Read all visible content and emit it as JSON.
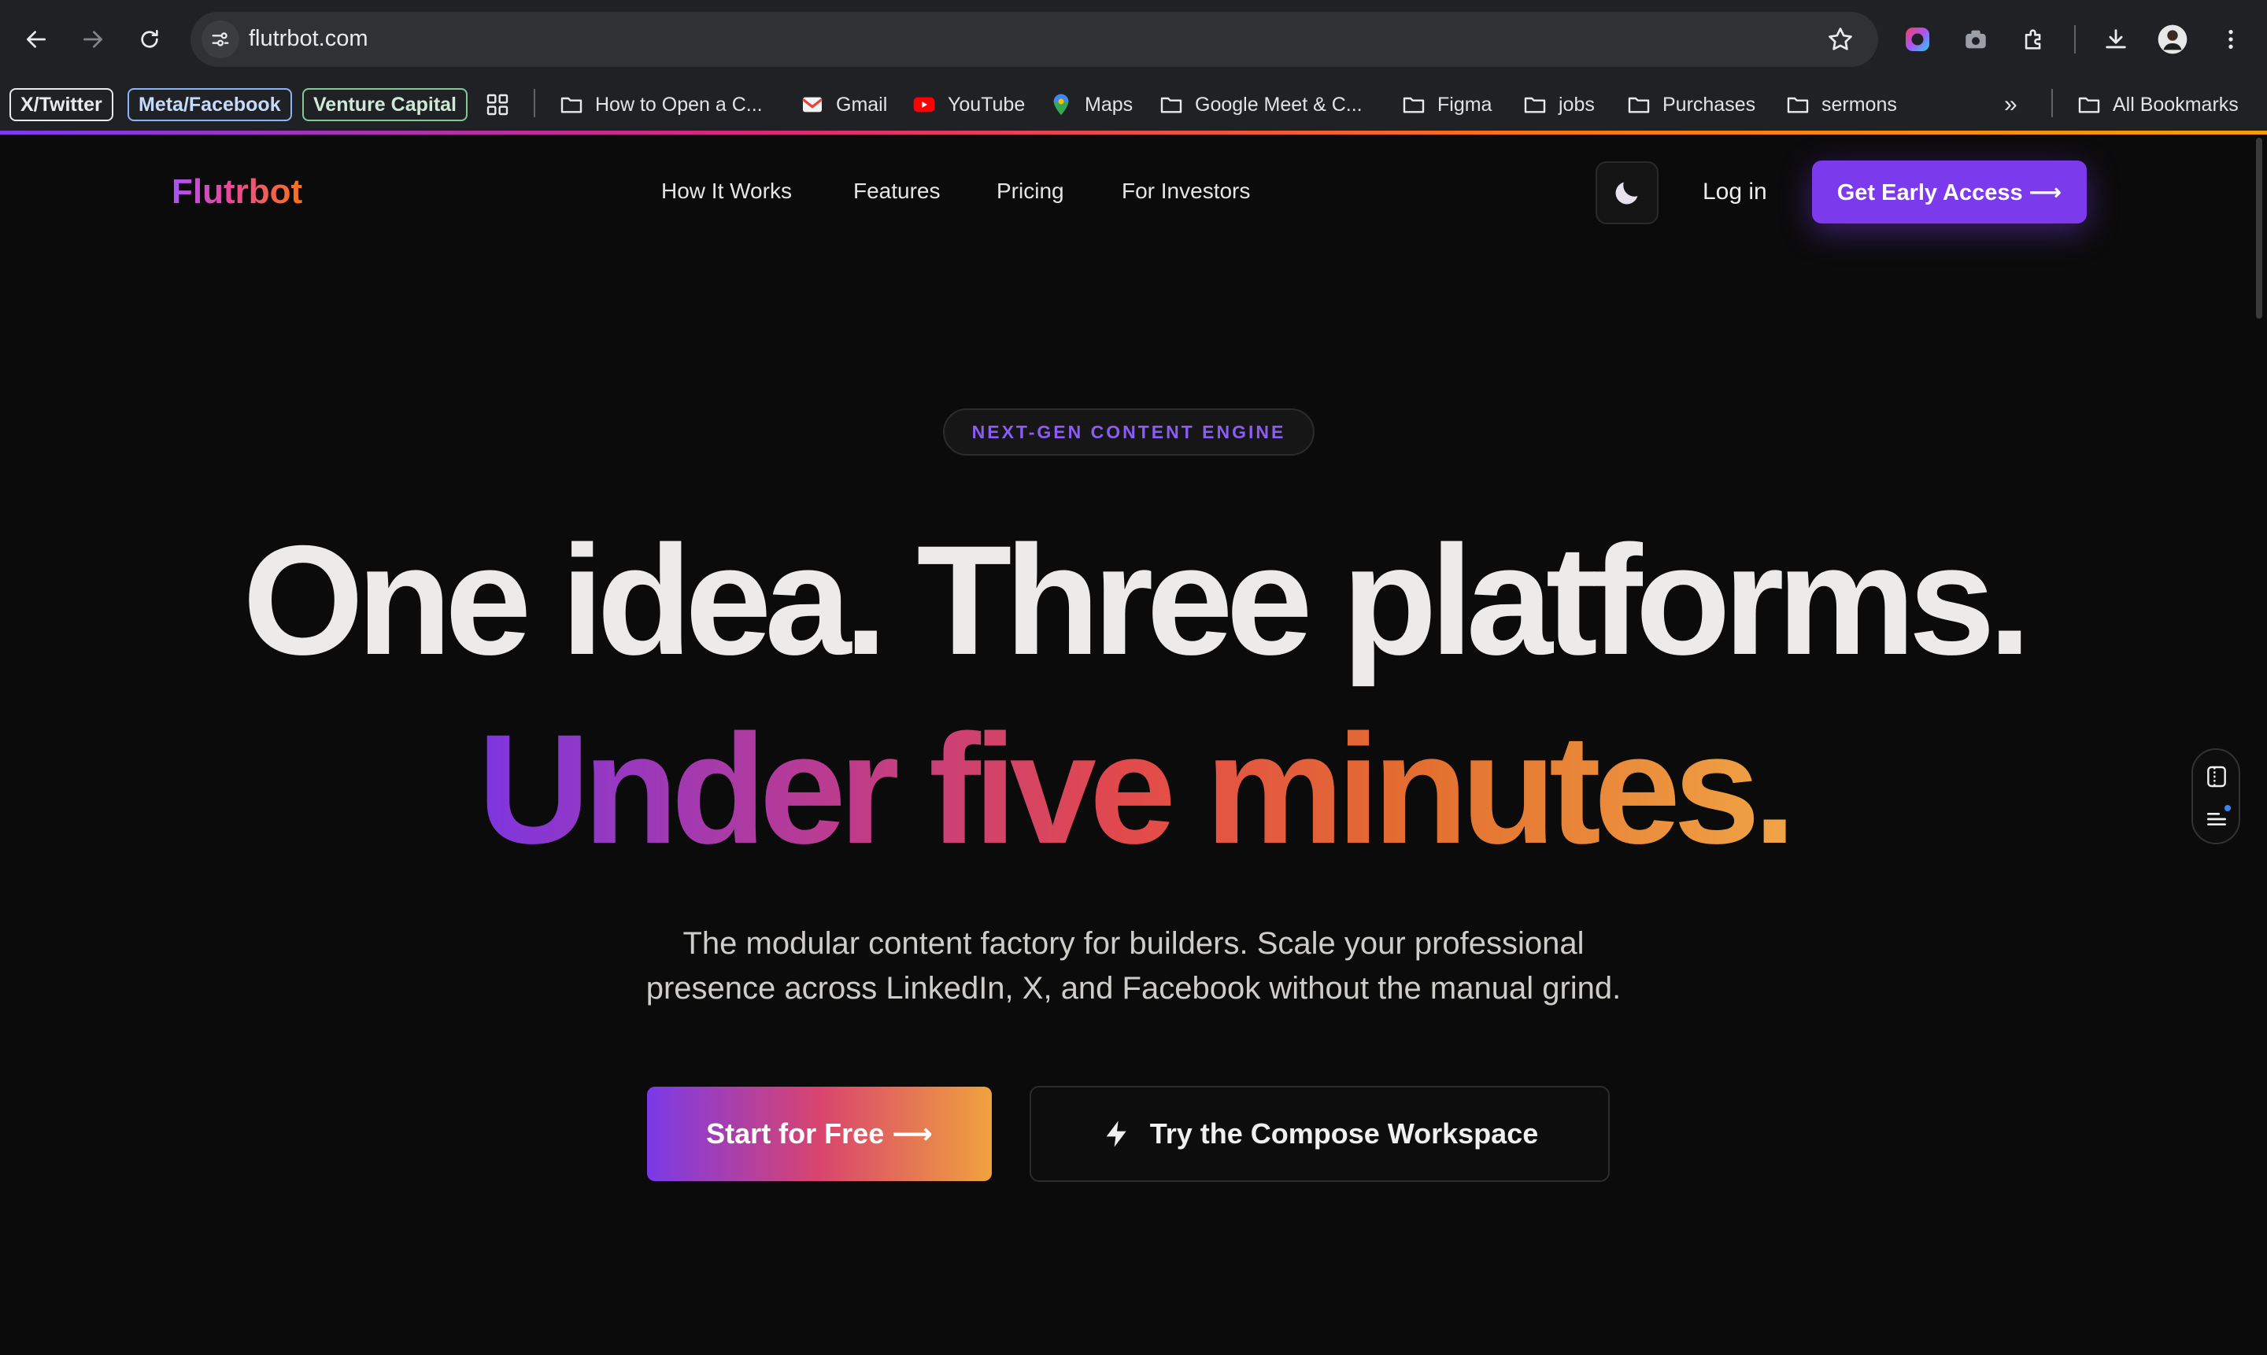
{
  "browser": {
    "url": "flutrbot.com",
    "bookmarks": {
      "chips": [
        {
          "label": "X/Twitter",
          "border": "#e8eaed",
          "color": "#e8eaed"
        },
        {
          "label": "Meta/Facebook",
          "border": "#8ab4f8",
          "color": "#c6dafc"
        },
        {
          "label": "Venture Capital",
          "border": "#81c995",
          "color": "#ceead6"
        }
      ],
      "items": [
        {
          "label": "How to Open a C...",
          "icon": "folder-icon"
        },
        {
          "label": "Gmail",
          "icon": "gmail-icon"
        },
        {
          "label": "YouTube",
          "icon": "youtube-icon"
        },
        {
          "label": "Maps",
          "icon": "maps-icon"
        },
        {
          "label": "Google Meet & C...",
          "icon": "folder-icon"
        },
        {
          "label": "Figma",
          "icon": "folder-icon"
        },
        {
          "label": "jobs",
          "icon": "folder-icon"
        },
        {
          "label": "Purchases",
          "icon": "folder-icon"
        },
        {
          "label": "sermons",
          "icon": "folder-icon"
        }
      ],
      "overflow": "»",
      "all_bookmarks": "All Bookmarks"
    }
  },
  "site": {
    "brand": "Flutrbot",
    "nav": [
      "How It Works",
      "Features",
      "Pricing",
      "For Investors"
    ],
    "login": "Log in",
    "cta_top": "Get Early Access ⟶",
    "badge": "NEXT-GEN CONTENT ENGINE",
    "headline_line1": "One idea. Three platforms.",
    "headline_line2": "Under five minutes.",
    "subhead_line1": "The modular content factory for builders. Scale your professional",
    "subhead_line2": "presence across LinkedIn, X, and Facebook without the manual grind.",
    "primary_button": "Start for Free ⟶",
    "secondary_button": "Try the Compose Workspace",
    "colors": {
      "accent": "#7c3aed",
      "background": "#0b0b0b"
    }
  }
}
